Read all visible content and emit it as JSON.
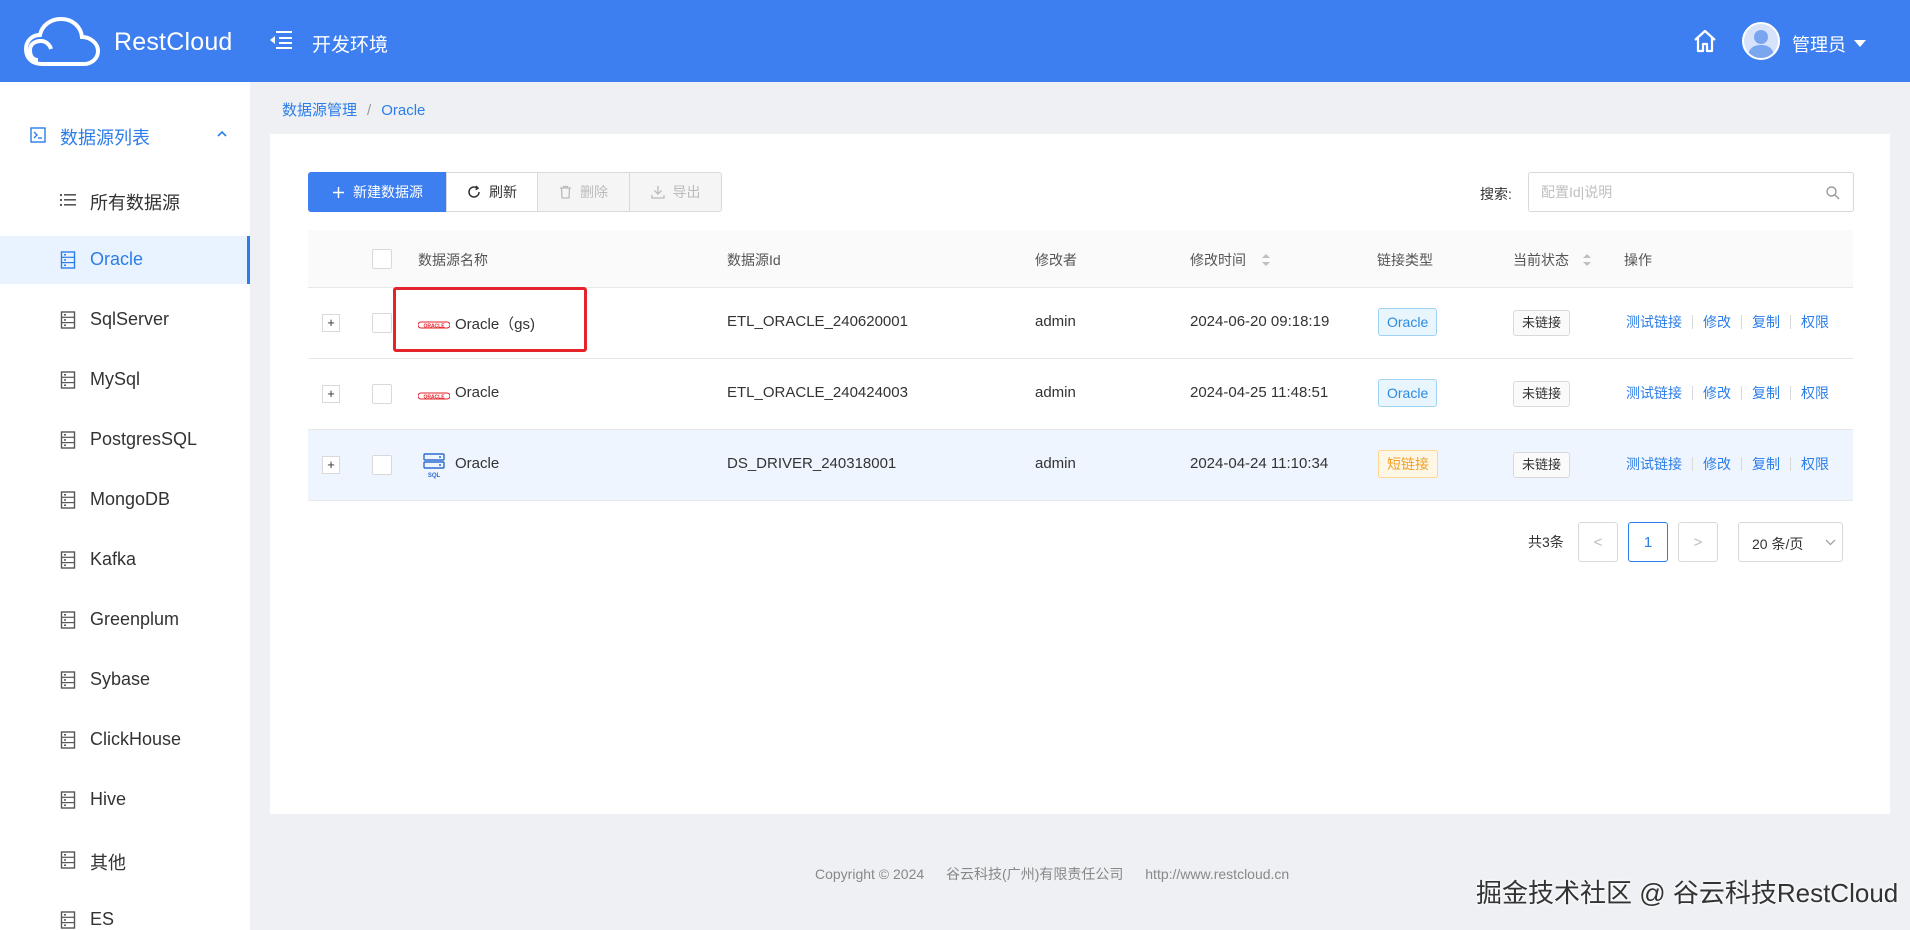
{
  "app": {
    "logo_text": "RestCloud",
    "env_title": "开发环境",
    "user_name": "管理员"
  },
  "sidebar": {
    "group_label": "数据源列表",
    "items": [
      {
        "label": "所有数据源",
        "icon": "list-icon"
      },
      {
        "label": "Oracle",
        "icon": "database-icon",
        "active": true
      },
      {
        "label": "SqlServer",
        "icon": "database-icon"
      },
      {
        "label": "MySql",
        "icon": "database-icon"
      },
      {
        "label": "PostgresSQL",
        "icon": "database-icon"
      },
      {
        "label": "MongoDB",
        "icon": "database-icon"
      },
      {
        "label": "Kafka",
        "icon": "database-icon"
      },
      {
        "label": "Greenplum",
        "icon": "database-icon"
      },
      {
        "label": "Sybase",
        "icon": "database-icon"
      },
      {
        "label": "ClickHouse",
        "icon": "database-icon"
      },
      {
        "label": "Hive",
        "icon": "database-icon"
      },
      {
        "label": "其他",
        "icon": "database-icon"
      },
      {
        "label": "ES",
        "icon": "database-icon"
      }
    ]
  },
  "breadcrumb": {
    "root": "数据源管理",
    "sep": "/",
    "current": "Oracle"
  },
  "toolbar": {
    "new_label": "新建数据源",
    "refresh_label": "刷新",
    "delete_label": "删除",
    "export_label": "导出"
  },
  "search": {
    "label": "搜索:",
    "placeholder": "配置Id|说明"
  },
  "table": {
    "columns": {
      "name": "数据源名称",
      "id": "数据源Id",
      "modifier": "修改者",
      "modified_time": "修改时间",
      "link_type": "链接类型",
      "status": "当前状态",
      "actions": "操作"
    },
    "rows": [
      {
        "name": "Oracle（gs)",
        "id": "ETL_ORACLE_240620001",
        "modifier": "admin",
        "modified_time": "2024-06-20 09:18:19",
        "link_type": "Oracle",
        "status": "未链接",
        "logo": "oracle-logo"
      },
      {
        "name": "Oracle",
        "id": "ETL_ORACLE_240424003",
        "modifier": "admin",
        "modified_time": "2024-04-25 11:48:51",
        "link_type": "Oracle",
        "status": "未链接",
        "logo": "oracle-logo"
      },
      {
        "name": "Oracle",
        "id": "DS_DRIVER_240318001",
        "modifier": "admin",
        "modified_time": "2024-04-24 11:10:34",
        "link_type": "短链接",
        "status": "未链接",
        "logo": "sql-server-logo"
      }
    ],
    "actions": [
      "测试链接",
      "修改",
      "复制",
      "权限"
    ],
    "expand_symbol": "+"
  },
  "pagination": {
    "total": "共3条",
    "prev": "<",
    "current": "1",
    "next": ">",
    "page_size": "20 条/页"
  },
  "footer": {
    "copyright": "Copyright © 2024",
    "company": "谷云科技(广州)有限责任公司",
    "url": "http://www.restcloud.cn"
  },
  "watermark": "掘金技术社区 @ 谷云科技RestCloud",
  "colors": {
    "header": "#3d7ff0",
    "accent": "#2b7de9",
    "highlight_box": "#e5232a",
    "oracle_red": "#e5232a",
    "short_link_tag": "#f0a024"
  }
}
